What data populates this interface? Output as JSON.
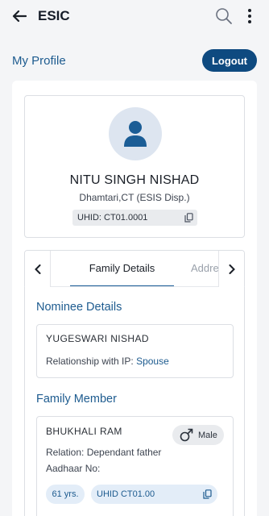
{
  "appbar": {
    "title": "ESIC",
    "icons": [
      "back-arrow-icon",
      "search-icon",
      "more-vert-icon"
    ]
  },
  "profile_section": {
    "heading": "My Profile",
    "logout_label": "Logout"
  },
  "profile_card": {
    "name": "NITU SINGH NISHAD",
    "location": "Dhamtari,CT (ESIS Disp.)",
    "uhid": "UHID: CT01.0001"
  },
  "tabs": {
    "items": [
      "Family Details",
      "Addre"
    ],
    "active": "Family Details"
  },
  "nominee": {
    "title": "Nominee Details",
    "name": "YUGESWARI NISHAD",
    "relationship_label": "Relationship with IP:",
    "relationship_value": "Spouse"
  },
  "family": {
    "title": "Family Member",
    "members": [
      {
        "name": "BHUKHALI RAM",
        "gender": "Male",
        "relation": "Relation: Dependant father",
        "aadhaar_label": "Aadhaar No:",
        "age": "61 yrs.",
        "uhid": "UHID CT01.00"
      }
    ]
  },
  "colors": {
    "primary": "#0e4a80",
    "accent_text": "#1d5b8f",
    "chip_bg": "#e9ebee",
    "pill_bg": "#e3edf8"
  }
}
